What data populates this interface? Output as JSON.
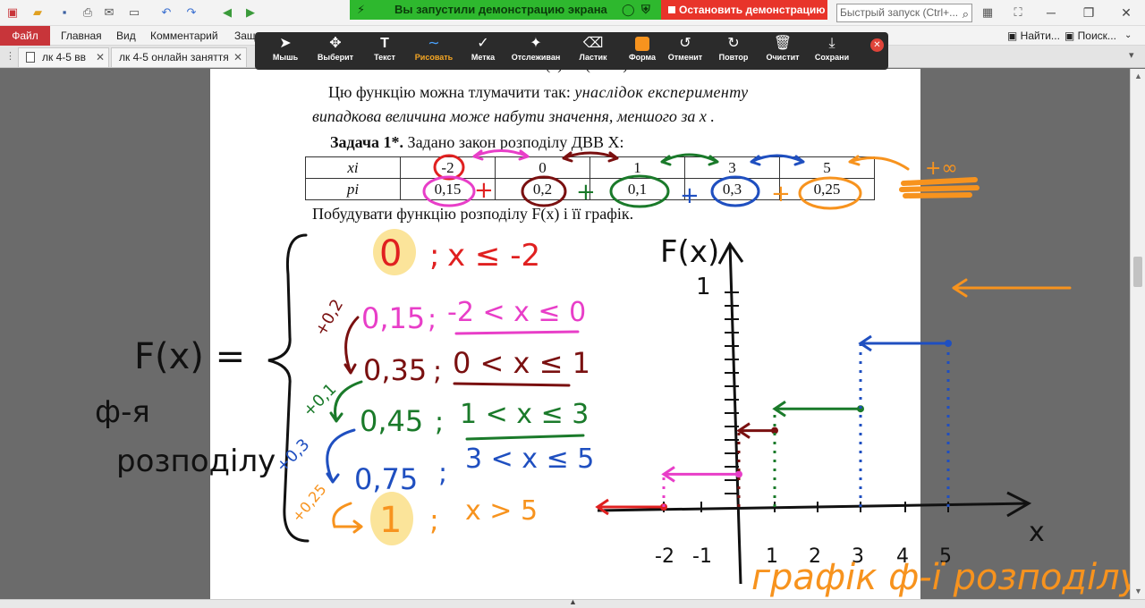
{
  "share": {
    "status": "Вы запустили демонстрацию экрана",
    "stop_label": "Остановить демонстрацию",
    "status_color": "#2eb82e",
    "stop_color": "#e8342a"
  },
  "quick_launch": {
    "placeholder": "Быстрый запуск (Ctrl+..."
  },
  "menu": {
    "file": "Файл",
    "items": [
      "Главная",
      "Вид",
      "Комментарий",
      "Защ"
    ],
    "find": "Найти...",
    "search": "Поиск..."
  },
  "tabs": [
    {
      "label": "лк 4-5 вв"
    },
    {
      "label": "лк 4-5 онлайн заняття"
    }
  ],
  "annotation_toolbar": {
    "tools": [
      {
        "label": "Мышь",
        "icon": "cursor-icon"
      },
      {
        "label": "Выберит",
        "icon": "move-icon"
      },
      {
        "label": "Текст",
        "icon": "text-icon"
      },
      {
        "label": "Рисовать",
        "icon": "draw-icon",
        "active": true
      },
      {
        "label": "Метка",
        "icon": "checkmark-icon"
      },
      {
        "label": "Отслеживан",
        "icon": "spotlight-icon"
      },
      {
        "label": "Ластик",
        "icon": "eraser-icon"
      },
      {
        "label": "Форма",
        "icon": "shape-icon"
      },
      {
        "label": "Отменит",
        "icon": "undo-icon"
      },
      {
        "label": "Повтор",
        "icon": "redo-icon"
      },
      {
        "label": "Очистит",
        "icon": "trash-icon"
      },
      {
        "label": "Сохрани",
        "icon": "save-icon"
      }
    ],
    "shape_color": "#f7931e"
  },
  "document": {
    "line1_plain": "Цю функцію можна тлумачити так: ",
    "line1_italic": "унаслідок експерименту",
    "line2_italic": "випадкова величина може набути значення, меншого за x .",
    "task_bold": "Задача 1*.",
    "task_text": " Задано закон розподілу ДВВ X:",
    "table": {
      "row_x_label": "xi",
      "row_p_label": "pi",
      "x_values": [
        "-2",
        "0",
        "1",
        "3",
        "5"
      ],
      "p_values": [
        "0,15",
        "0,2",
        "0,1",
        "0,3",
        "0,25"
      ]
    },
    "build_text": "Побудувати функцію розподілу F(x) і її графік."
  },
  "handwriting": {
    "f_label": "F(x) =",
    "f_desc_1": "ф-я",
    "f_desc_2": "розподілу",
    "cases": [
      {
        "value": "0",
        "cond": "x ≤ -2"
      },
      {
        "value": "0,15",
        "cond": "-2 < x ≤ 0"
      },
      {
        "value": "0,35",
        "cond": "0 < x ≤ 1"
      },
      {
        "value": "0,45",
        "cond": "1 < x ≤ 3"
      },
      {
        "value": "0,75",
        "cond": "3 < x ≤ 5"
      },
      {
        "value": "1",
        "cond": "x > 5"
      }
    ],
    "increments": [
      "+0,2",
      "+0,1",
      "+0,3",
      "+0,25"
    ],
    "plus_infinity": "+∞",
    "graph_ylabel": "F(x)",
    "graph_xlabel": "x",
    "graph_ytick": "1",
    "graph_xticks": [
      "-2",
      "-1",
      "1",
      "2",
      "3",
      "4",
      "5"
    ],
    "graph_caption": "графік ф-ї розподілу",
    "colors": {
      "red": "#e02020",
      "pink": "#e83ec8",
      "maroon": "#7a1010",
      "green": "#1a7a2a",
      "blue": "#1f4fc0",
      "orange": "#f7931e",
      "black": "#111111",
      "highlight": "#fbe49a"
    }
  }
}
